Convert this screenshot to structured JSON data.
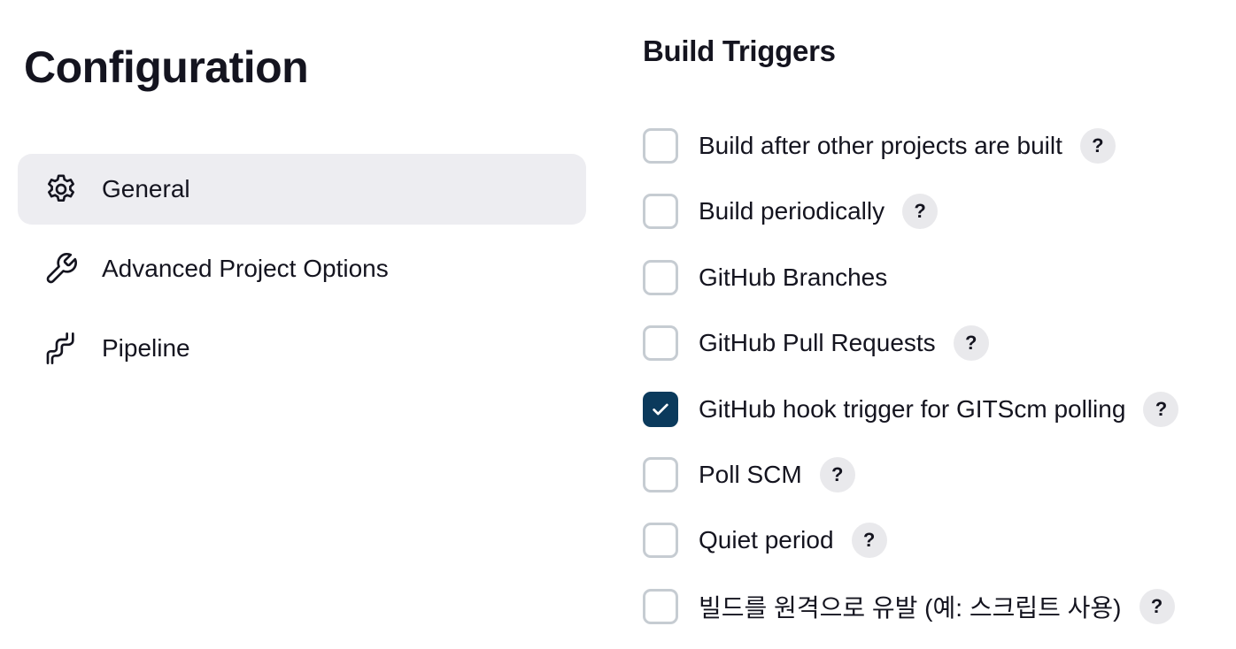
{
  "sidebar": {
    "title": "Configuration",
    "items": [
      {
        "label": "General",
        "icon": "gear-icon",
        "active": true
      },
      {
        "label": "Advanced Project Options",
        "icon": "wrench-icon",
        "active": false
      },
      {
        "label": "Pipeline",
        "icon": "pipeline-icon",
        "active": false
      }
    ]
  },
  "build_triggers": {
    "title": "Build Triggers",
    "help_label": "?",
    "options": [
      {
        "label": "Build after other projects are built",
        "checked": false,
        "has_help": true
      },
      {
        "label": "Build periodically",
        "checked": false,
        "has_help": true
      },
      {
        "label": "GitHub Branches",
        "checked": false,
        "has_help": false
      },
      {
        "label": "GitHub Pull Requests",
        "checked": false,
        "has_help": true
      },
      {
        "label": "GitHub hook trigger for GITScm polling",
        "checked": true,
        "has_help": true
      },
      {
        "label": "Poll SCM",
        "checked": false,
        "has_help": true
      },
      {
        "label": "Quiet period",
        "checked": false,
        "has_help": true
      },
      {
        "label": "빌드를 원격으로 유발 (예: 스크립트 사용)",
        "checked": false,
        "has_help": true
      }
    ]
  },
  "colors": {
    "checked_bg": "#0b3a5c",
    "active_nav_bg": "#ededf1",
    "checkbox_border": "#c6ccd2",
    "help_bg": "#e9e9ec"
  }
}
